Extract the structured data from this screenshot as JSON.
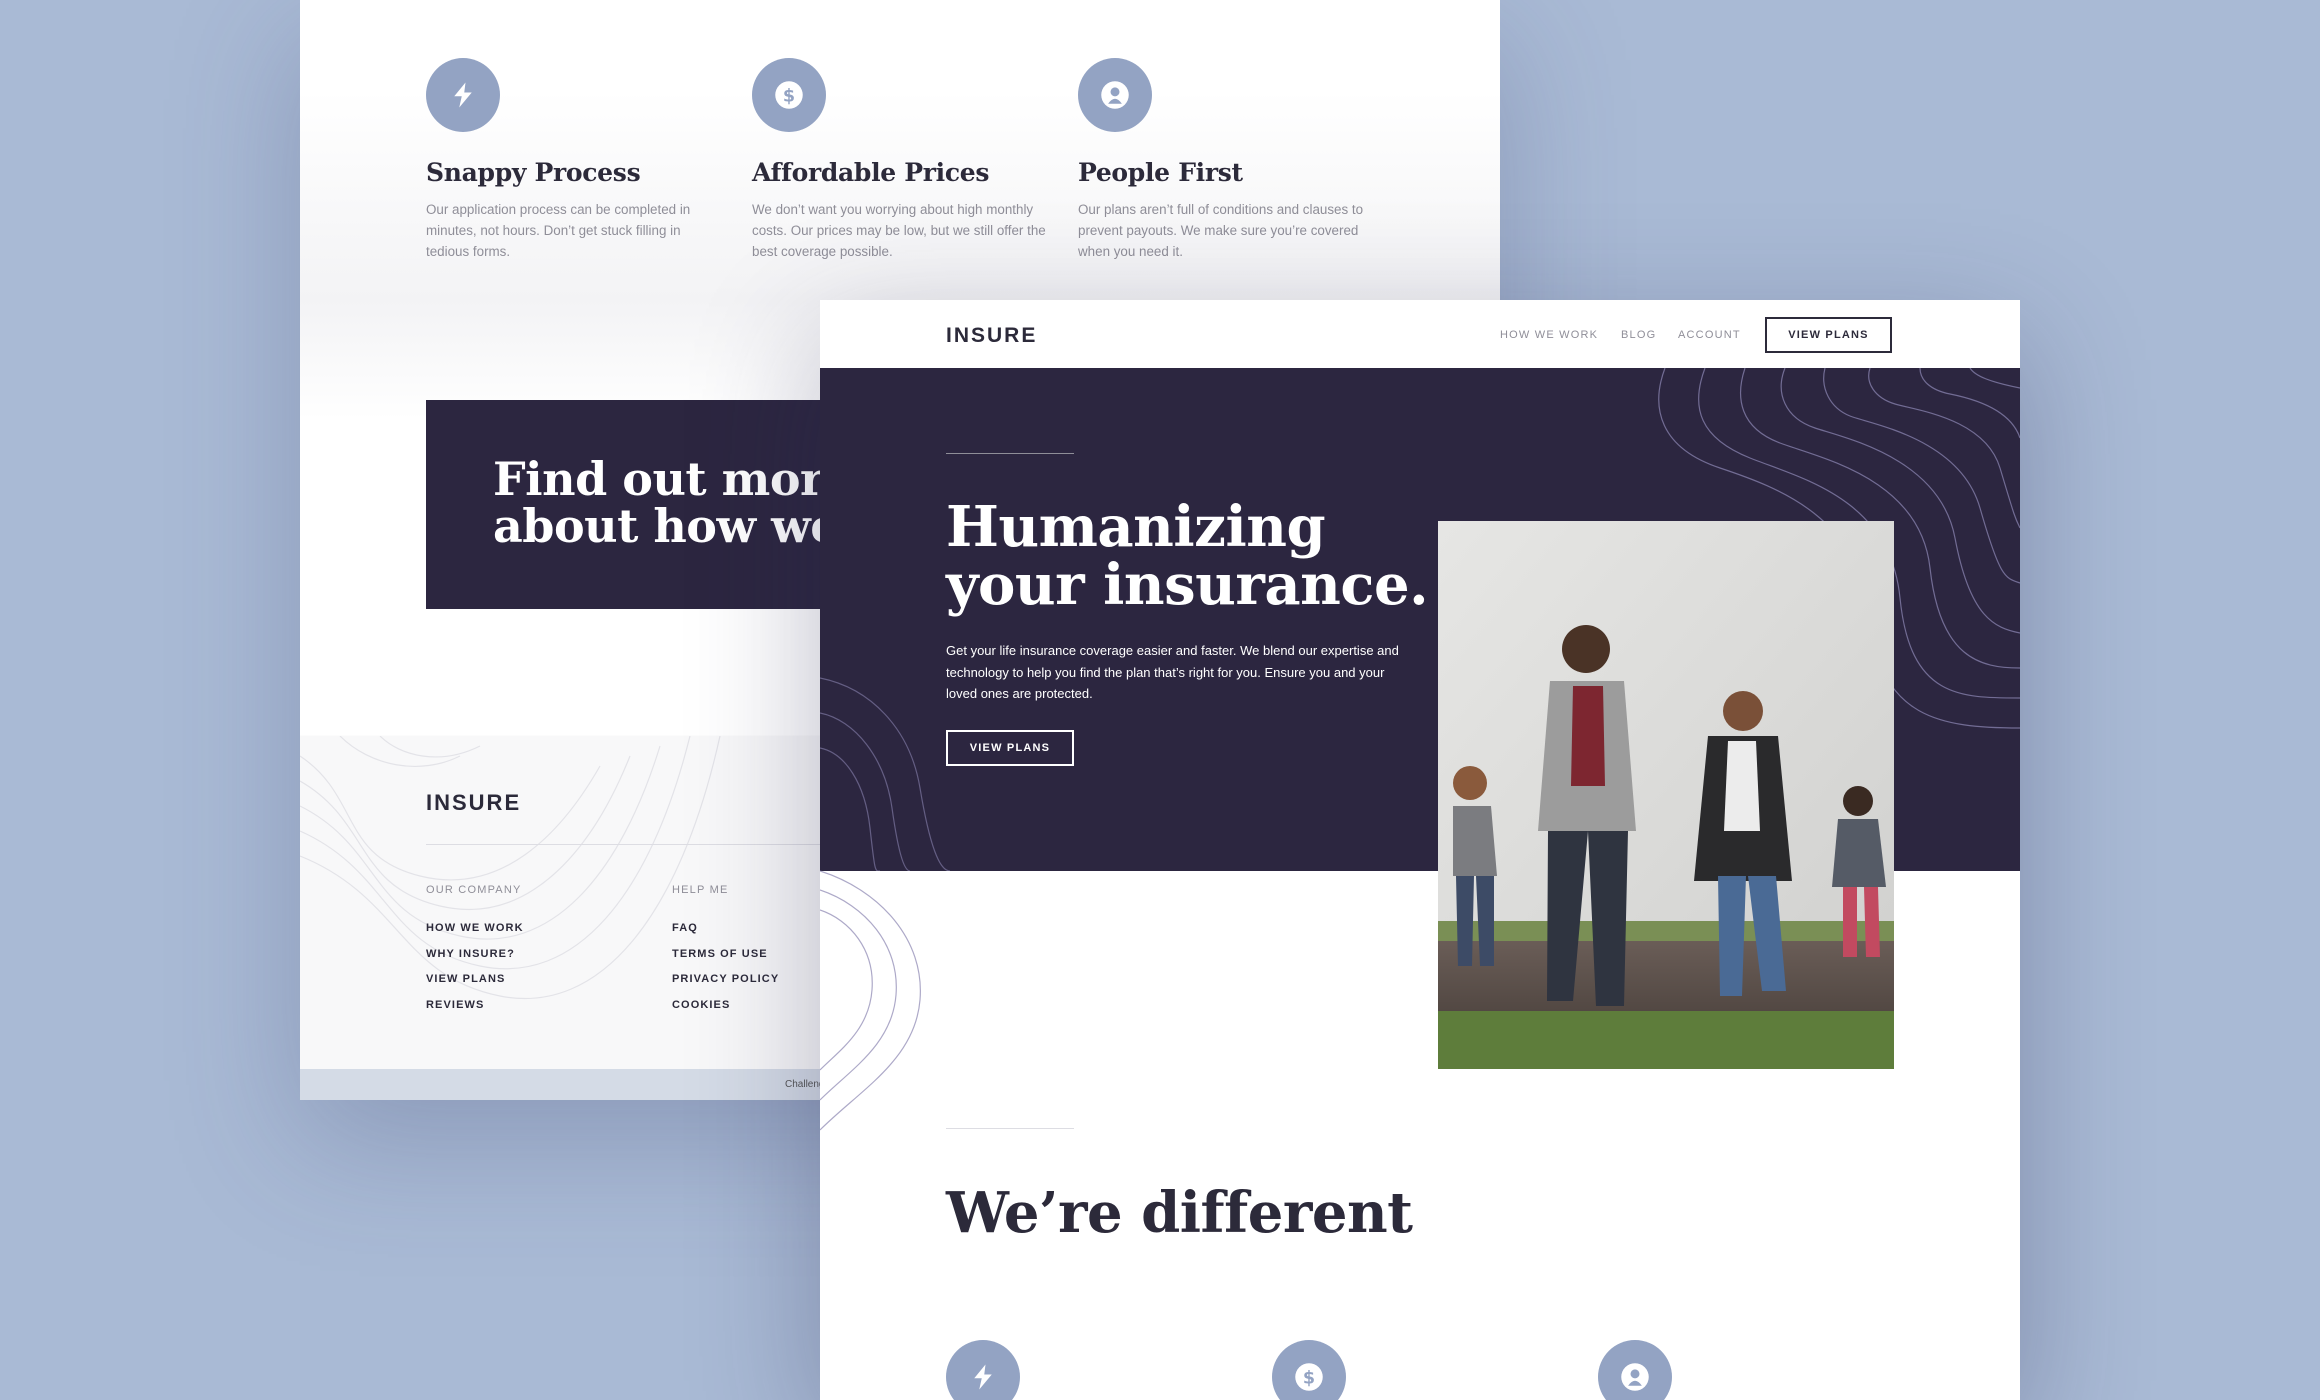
{
  "back_page": {
    "features": [
      {
        "title": "Snappy Process",
        "text": "Our application process can be completed in minutes, not hours. Don’t get stuck filling in tedious forms.",
        "icon": "lightning-icon"
      },
      {
        "title": "Affordable Prices",
        "text": "We don’t want you worrying about high monthly costs. Our prices may be low, but we still offer the best coverage possible.",
        "icon": "dollar-icon"
      },
      {
        "title": "People First",
        "text": "Our plans aren’t full of conditions and clauses to prevent payouts. We make sure you’re covered when you need it.",
        "icon": "person-icon"
      }
    ],
    "cta_title": "Find out more\nabout how we w",
    "footer": {
      "logo": "INSURE",
      "columns": [
        {
          "heading": "OUR COMPANY",
          "links": [
            "HOW WE WORK",
            "WHY INSURE?",
            "VIEW PLANS",
            "REVIEWS"
          ]
        },
        {
          "heading": "HELP ME",
          "links": [
            "FAQ",
            "TERMS OF USE",
            "PRIVACY POLICY",
            "COOKIES"
          ]
        }
      ],
      "attribution": "Challeng"
    }
  },
  "front_page": {
    "nav": {
      "logo": "INSURE",
      "links": [
        "HOW WE WORK",
        "BLOG",
        "ACCOUNT"
      ],
      "button": "VIEW PLANS"
    },
    "hero": {
      "title": "Humanizing\nyour insurance.",
      "text": "Get your life insurance coverage easier and faster. We blend our expertise and technology to help you find the plan that’s right for you. Ensure you and your loved ones are protected.",
      "button": "VIEW PLANS",
      "photo": "family-walking-photo"
    },
    "different_title": "We’re different",
    "feature_icons": [
      "lightning-icon",
      "dollar-icon",
      "person-icon"
    ]
  },
  "colors": {
    "background": "#a9bad5",
    "dark_violet": "#2c2640",
    "icon_blue": "#93a3c3",
    "text_dark": "#2c2a3a",
    "text_grey": "#8f8e98"
  }
}
